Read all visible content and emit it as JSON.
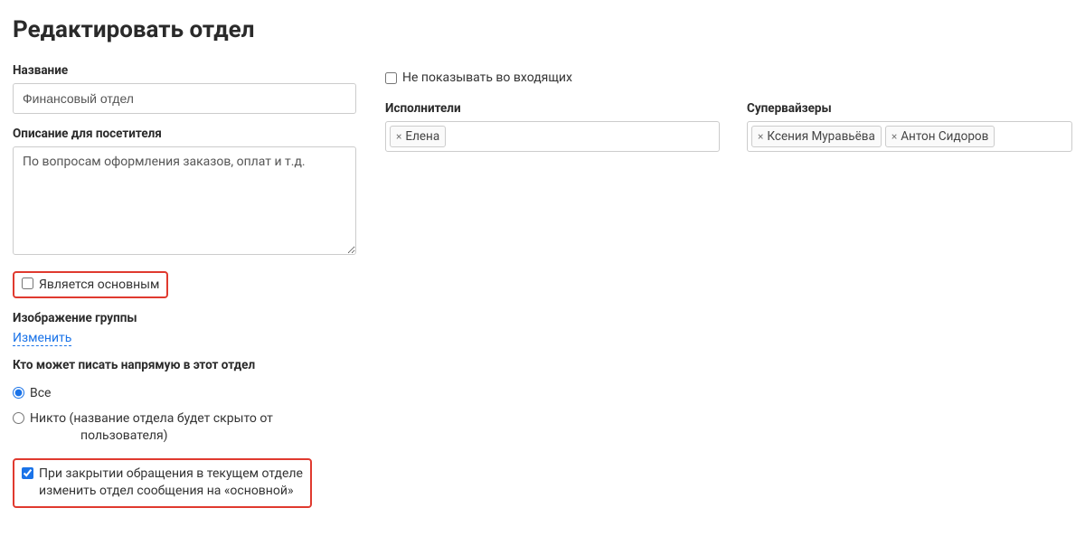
{
  "page_title": "Редактировать отдел",
  "left": {
    "name_label": "Название",
    "name_value": "Финансовый отдел",
    "desc_label": "Описание для посетителя",
    "desc_value": "По вопросам оформления заказов, оплат и т.д.",
    "is_main_label": "Является основным",
    "group_image_label": "Изображение группы",
    "change_link": "Изменить",
    "who_can_write_label": "Кто может писать напрямую в этот отдел",
    "radio_all": "Все",
    "radio_none": "Никто (название отдела будет скрыто от",
    "radio_none_line2": "пользователя)",
    "on_close_line1": "При закрытии обращения в текущем отделе",
    "on_close_line2": "изменить отдел сообщения на «основной»"
  },
  "right": {
    "hide_in_inbox_label": "Не показывать во входящих",
    "executors_label": "Исполнители",
    "supervisors_label": "Супервайзеры",
    "executors": [
      "Елена"
    ],
    "supervisors": [
      "Ксения Муравьёва",
      "Антон Сидоров"
    ]
  }
}
